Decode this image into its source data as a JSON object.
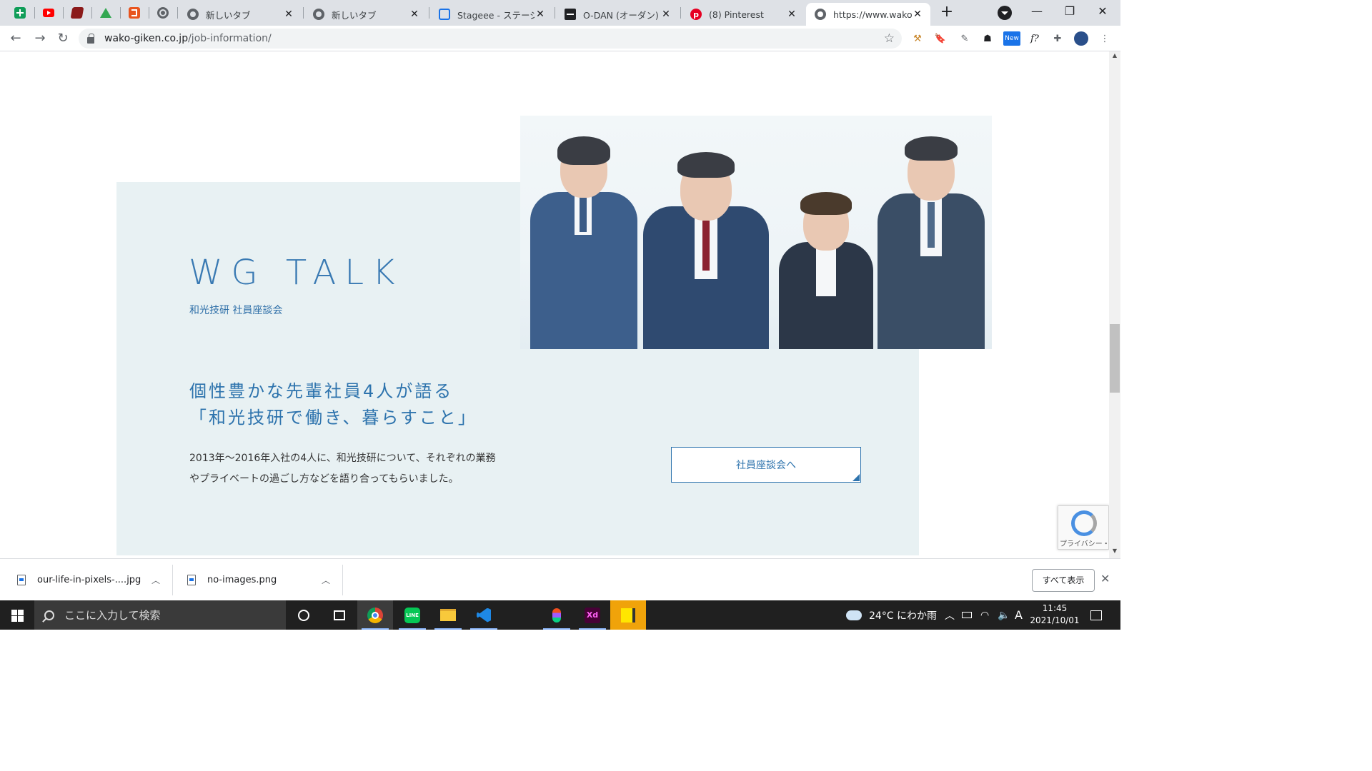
{
  "browser": {
    "pinned_tabs": [
      {
        "icon": "google-sheets-icon",
        "color": "#0f9d58"
      },
      {
        "icon": "youtube-icon",
        "color": "#ff0000"
      },
      {
        "icon": "book-icon",
        "color": "#8b1a1a"
      },
      {
        "icon": "triangle-app-icon",
        "color": "#34a853"
      },
      {
        "icon": "html5-icon",
        "color": "#e8541e"
      },
      {
        "icon": "globe-icon",
        "color": "#5f6368"
      }
    ],
    "tabs": [
      {
        "title": "新しいタブ",
        "icon": "chrome-icon"
      },
      {
        "title": "新しいタブ",
        "icon": "chrome-icon"
      },
      {
        "title": "Stageee - ステージー",
        "icon": "stageee-icon"
      },
      {
        "title": "O-DAN (オーダン) - 無",
        "icon": "odan-icon"
      },
      {
        "title": "(8) Pinterest",
        "icon": "pinterest-icon"
      },
      {
        "title": "https://www.wako-g",
        "icon": "globe-icon",
        "active": true
      }
    ],
    "address": {
      "host": "wako-giken.co.jp",
      "path": "/job-information/"
    }
  },
  "page": {
    "wg_title": "WG TALK",
    "wg_subtitle": "和光技研 社員座談会",
    "headline_line1": "個性豊かな先輩社員4人が語る",
    "headline_line2": "「和光技研で働き、暮らすこと」",
    "body_line1": "2013年〜2016年入社の4人に、和光技研について、それぞれの業務",
    "body_line2": "やプライベートの過ごし方などを語り合ってもらいました。",
    "cta_label": "社員座談会へ",
    "recaptcha_text": "プライバシー・利用規約",
    "accent_color": "#2d73ad",
    "panel_color": "#e8f1f3"
  },
  "downloads": {
    "items": [
      {
        "name": "our-life-in-pixels-....jpg"
      },
      {
        "name": "no-images.png"
      }
    ],
    "show_all": "すべて表示"
  },
  "taskbar": {
    "search_placeholder": "ここに入力して検索",
    "weather": "24°C にわか雨",
    "ime": "A",
    "time": "11:45",
    "date": "2021/10/01"
  }
}
